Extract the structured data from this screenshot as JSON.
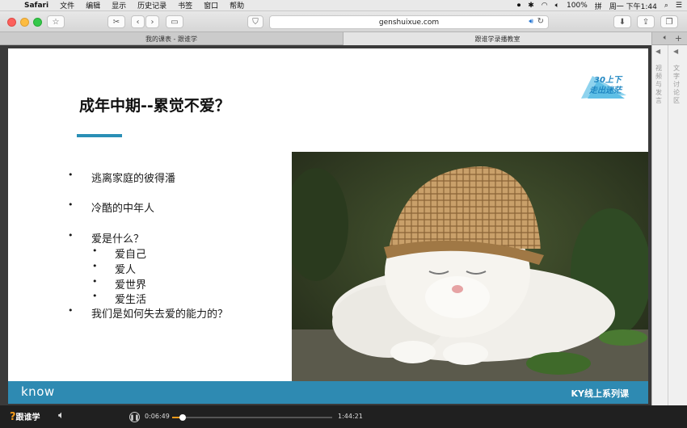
{
  "menubar": {
    "app": "Safari",
    "items": [
      "文件",
      "编辑",
      "显示",
      "历史记录",
      "书签",
      "窗口",
      "帮助"
    ],
    "battery": "100%",
    "input_method": "拼",
    "clock": "周一 下午1:44"
  },
  "browser": {
    "url": "genshuixue.com",
    "tabs": [
      {
        "label": "我的课表 - 跟谁学"
      },
      {
        "label": "跟谁学录播教室"
      }
    ]
  },
  "slide": {
    "title": "成年中期--累觉不爱？",
    "badge_line1": "30上下",
    "badge_line2": "走出迷茫",
    "bullets": [
      {
        "text": "逃离家庭的彼得潘"
      },
      {
        "text": "冷酷的中年人"
      },
      {
        "text": "爱是什么？"
      }
    ],
    "sub_bullets": [
      {
        "text": "爱自己"
      },
      {
        "text": "爱人"
      },
      {
        "text": "爱世界"
      },
      {
        "text": "爱生活"
      }
    ],
    "last_bullet": "我们是如何失去爱的能力的？",
    "footer_logo": "know",
    "footer_course": "KY线上系列课"
  },
  "sidebar": {
    "col1": "视频与发言",
    "col2": "文字讨论区"
  },
  "player": {
    "logo_text": "跟谁学",
    "current_time": "0:06:49",
    "duration": "1:44:21",
    "progress": 0.065
  },
  "colors": {
    "accent_blue": "#2e8ab2",
    "player_orange": "#f29a1a"
  }
}
